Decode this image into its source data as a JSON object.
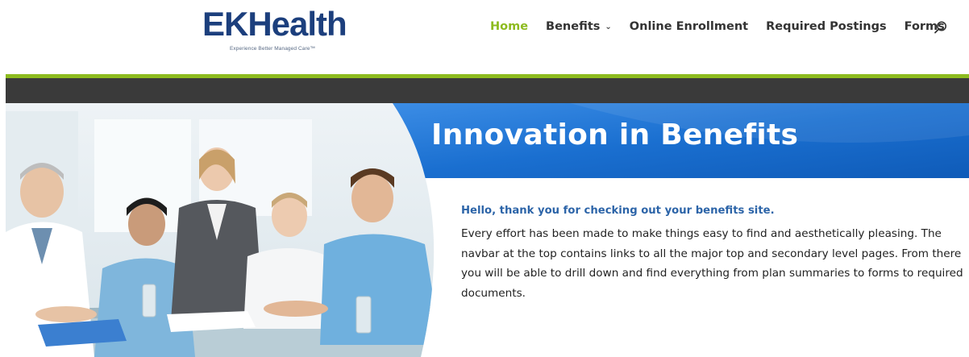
{
  "brand": {
    "logo_text": "EKHealth",
    "tagline": "Experience Better Managed Care™"
  },
  "nav": {
    "items": [
      {
        "label": "Home",
        "active": true
      },
      {
        "label": "Benefits",
        "has_dropdown": true
      },
      {
        "label": "Online Enrollment"
      },
      {
        "label": "Required Postings"
      },
      {
        "label": "Forms"
      }
    ],
    "search_icon": "search-icon"
  },
  "colors": {
    "accent_green": "#8dbb1f",
    "brand_navy": "#1c3f7d",
    "banner_blue": "#1a6fd0",
    "hello_blue": "#2c64a8",
    "dark_bar": "#3a3a3a"
  },
  "banner": {
    "title": "Innovation in Benefits",
    "hello": "Hello, thank you for checking out your benefits site.",
    "body": "Every effort has been made to make things easy to find and aesthetically pleasing. The navbar at the top contains links to all the major top and secondary level pages. From there you will be able to drill down and find everything from plan summaries to forms to required documents."
  }
}
